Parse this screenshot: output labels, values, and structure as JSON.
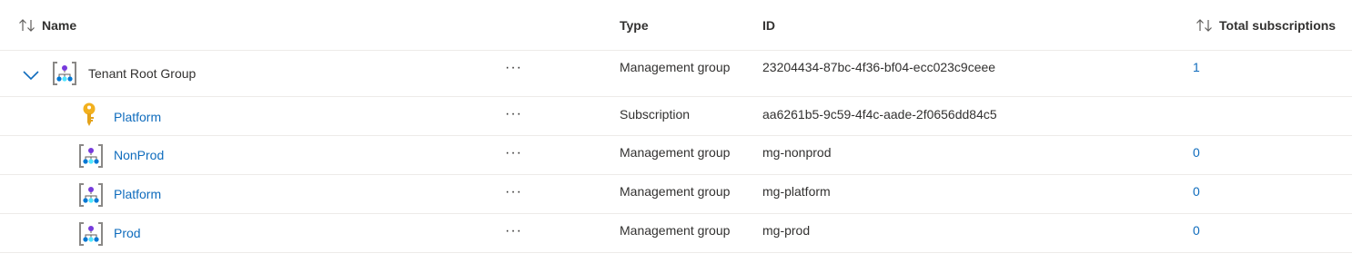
{
  "columns": {
    "name": "Name",
    "type": "Type",
    "id": "ID",
    "total": "Total subscriptions"
  },
  "rows": [
    {
      "name": "Tenant Root Group",
      "type": "Management group",
      "id": "23204434-87bc-4f36-bf04-ecc023c9ceee",
      "total": "1",
      "icon": "management-group-icon",
      "expanded": true
    },
    {
      "name": "Platform",
      "type": "Subscription",
      "id": "aa6261b5-9c59-4f4c-aade-2f0656dd84c5",
      "total": "",
      "icon": "key-icon"
    },
    {
      "name": "NonProd",
      "type": "Management group",
      "id": "mg-nonprod",
      "total": "0",
      "icon": "management-group-icon"
    },
    {
      "name": "Platform",
      "type": "Management group",
      "id": "mg-platform",
      "total": "0",
      "icon": "management-group-icon"
    },
    {
      "name": "Prod",
      "type": "Management group",
      "id": "mg-prod",
      "total": "0",
      "icon": "management-group-icon"
    }
  ],
  "more_label": "···",
  "colors": {
    "link": "#0f6cbd",
    "text": "#323130",
    "divider": "#edebe9",
    "key": "#f2b01e"
  }
}
